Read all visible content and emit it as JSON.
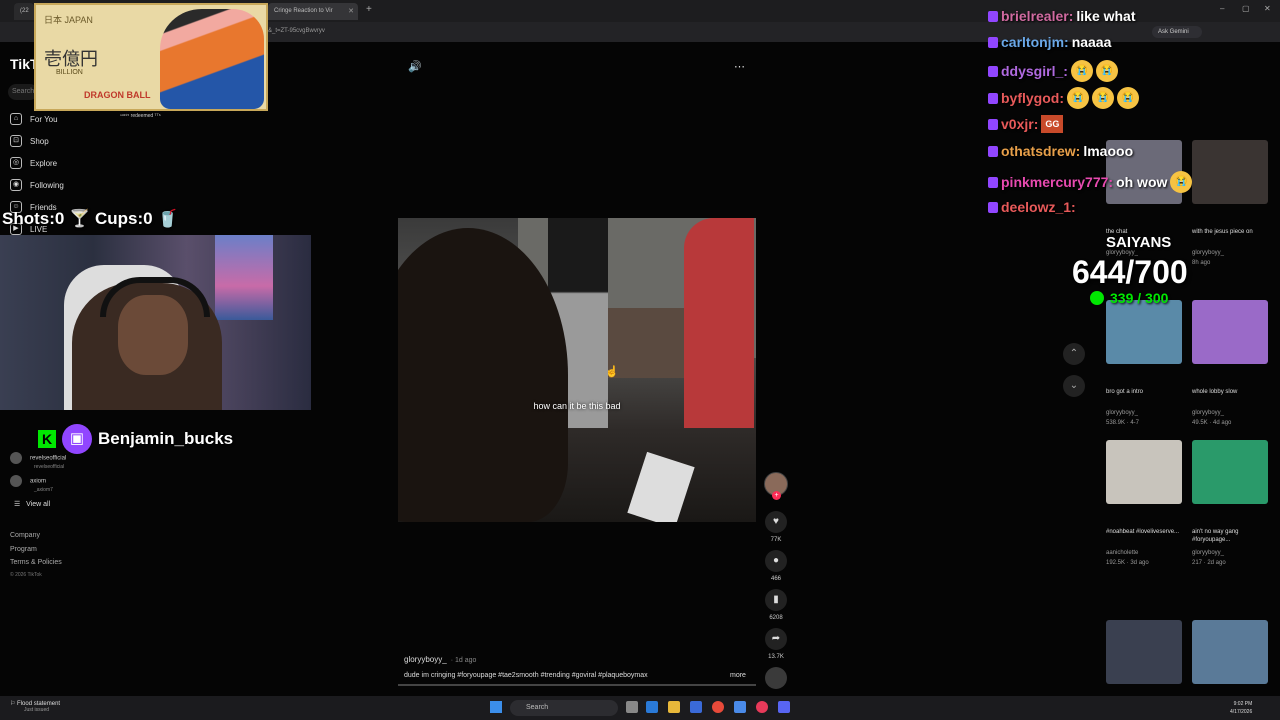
{
  "browser": {
    "tab1_label": "(22",
    "tab2_label": "Cringe Reaction to Vir",
    "new_tab": "+",
    "url": "&_t=ZT-95cvgBwvryv",
    "ask_gemini": "Ask Gemini",
    "min": "–",
    "max": "▢",
    "close": "✕"
  },
  "tiktok": {
    "logo": "TikTok",
    "search_placeholder": "Search",
    "nav": [
      {
        "label": "For You",
        "icon": "⌂"
      },
      {
        "label": "Shop",
        "icon": "⊡"
      },
      {
        "label": "Explore",
        "icon": "◎"
      },
      {
        "label": "Following",
        "icon": "◉"
      },
      {
        "label": "Friends",
        "icon": "☺"
      },
      {
        "label": "LIVE",
        "icon": "▶"
      }
    ],
    "following": [
      {
        "name": "revelseofficial",
        "handle": "revelseofficial"
      },
      {
        "name": "axiom",
        "handle": "_axiom7"
      }
    ],
    "view_all": "View all",
    "footer": [
      "Company",
      "Program",
      "Terms & Policies"
    ],
    "copyright": "© 2026 TikTok",
    "video": {
      "caption": "how can it be this bad",
      "author": "gloryyboyy_",
      "ago": "· 1d ago",
      "description": "dude im cringing #foryoupage #tae2smooth #trending #goviral #plaqueboymax",
      "more": "more"
    },
    "actions": {
      "likes": "77K",
      "comments": "466",
      "saves": "6208",
      "shares": "13.7K",
      "follow_plus": "+"
    }
  },
  "stream": {
    "shots_cups": "Shots:0 🍸 Cups:0 🥤",
    "redeemed": "ⁿᵘᶻ¹⁵ redeemed ᵀᵀˢ",
    "card": {
      "japan": "日本 JAPAN",
      "yen": "壱億円",
      "billion": "BILLION",
      "db": "DRAGON BALL"
    },
    "k_icon": "K",
    "tw_icon": "▣",
    "username": "Benjamin_bucks",
    "saiyans": "SAIYANS",
    "goal": "644/700",
    "sub_goal": "339 / 300"
  },
  "chat": [
    {
      "name": "brielrealer:",
      "msg": "like what",
      "color": "#d06aa0",
      "emotes": 0
    },
    {
      "name": "carltonjm:",
      "msg": "naaaa",
      "color": "#6aa8e8",
      "emotes": 0
    },
    {
      "name": "ddysgirl_:",
      "msg": "",
      "color": "#b06ae0",
      "emotes": 2
    },
    {
      "name": "byflygod:",
      "msg": "",
      "color": "#e85a5a",
      "emotes": 3
    },
    {
      "name": "v0xjr:",
      "msg": "GG",
      "color": "#e85a5a",
      "emotes": 0
    },
    {
      "name": "othatsdrew:",
      "msg": "lmaooo",
      "color": "#e8a04a",
      "emotes": 0
    },
    {
      "name": "pinkmercury777:",
      "msg": "oh wow",
      "color": "#e84ab0",
      "emotes": 1
    },
    {
      "name": "deelowz_1:",
      "msg": "",
      "color": "#e85a5a",
      "emotes": 0
    }
  ],
  "emote_glyph": "😭",
  "grid": [
    {
      "caption": "the chat",
      "user": "gloryyboyy_",
      "stat": "",
      "color": "#6b6a78"
    },
    {
      "caption": "with the jesus piece on",
      "user": "gloryyboyy_",
      "stat": "8h ago",
      "color": "#3a3432"
    },
    {
      "caption": "bro got a intro",
      "user": "gloryyboyy_",
      "stat": "538.9K · 4-7",
      "color": "#5a8aa8"
    },
    {
      "caption": "whole lobby slow",
      "user": "gloryyboyy_",
      "stat": "49.5K · 4d ago",
      "color": "#9a6ac8"
    },
    {
      "caption": "#noahbeat #loveliveserve...",
      "user": "aanicholette",
      "stat": "192.5K · 3d ago",
      "color": "#c8c4bc"
    },
    {
      "caption": "ain't no way gang #foryoupage...",
      "user": "gloryyboyy_",
      "stat": "217 · 2d ago",
      "color": "#2a9a6a"
    },
    {
      "caption": "",
      "user": "",
      "stat": "",
      "color": "#3a4050"
    },
    {
      "caption": "",
      "user": "",
      "stat": "",
      "color": "#5a7a98"
    }
  ],
  "taskbar": {
    "news_title": "Flood statement",
    "news_sub": "Just issued",
    "search": "Search",
    "time": "9:02 PM",
    "date": "4/17/2026"
  }
}
